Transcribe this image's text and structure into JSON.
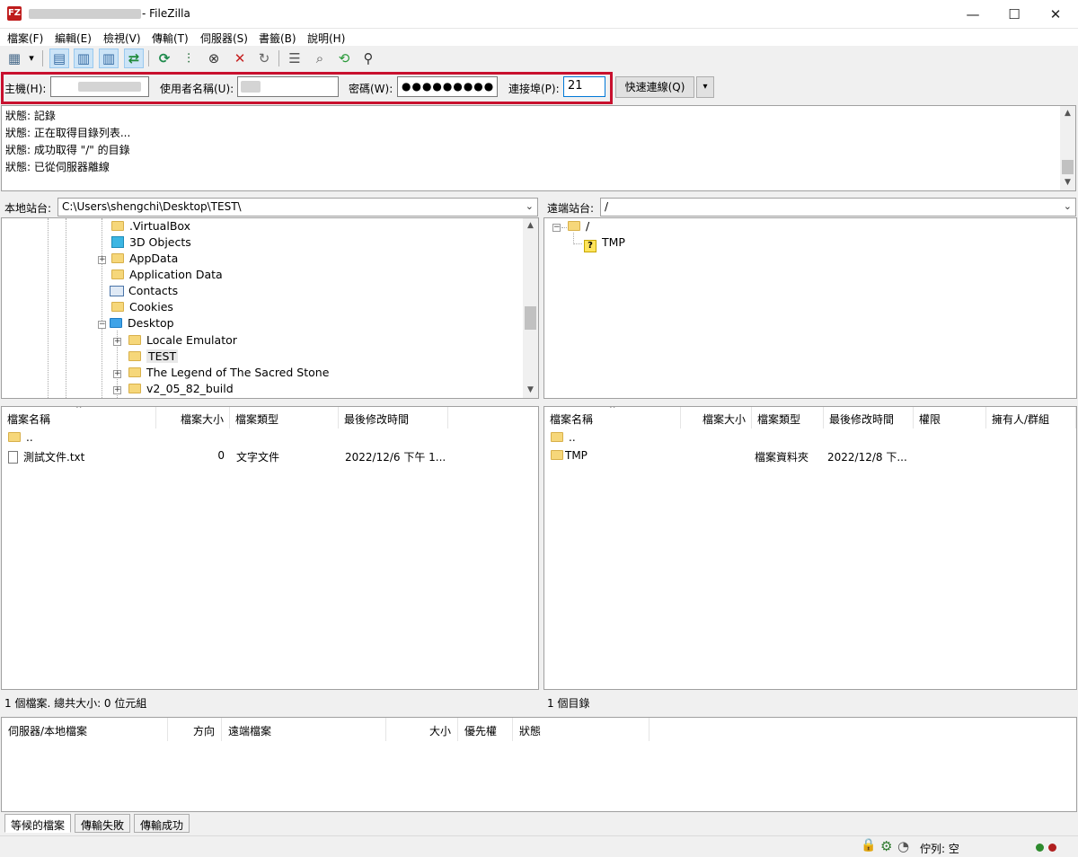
{
  "window": {
    "title_suffix": "- FileZilla",
    "icon_label": "FZ",
    "minimize": "—",
    "maximize": "☐",
    "close": "✕"
  },
  "menu": {
    "items": [
      "檔案(F)",
      "編輯(E)",
      "檢視(V)",
      "傳輸(T)",
      "伺服器(S)",
      "書籤(B)",
      "說明(H)"
    ]
  },
  "toolbar": {
    "icons": [
      {
        "name": "site-manager-icon",
        "glyph": "▦"
      },
      {
        "name": "dropdown-arrow-icon",
        "glyph": "▾"
      },
      {
        "name": "toggle-log-icon",
        "glyph": "▤"
      },
      {
        "name": "toggle-local-tree-icon",
        "glyph": "▥"
      },
      {
        "name": "toggle-remote-tree-icon",
        "glyph": "▥"
      },
      {
        "name": "toggle-queue-icon",
        "glyph": "⇄"
      },
      {
        "name": "refresh-icon",
        "glyph": "⟳"
      },
      {
        "name": "process-queue-icon",
        "glyph": "⫶"
      },
      {
        "name": "cancel-icon",
        "glyph": "⊗"
      },
      {
        "name": "disconnect-icon",
        "glyph": "✕"
      },
      {
        "name": "reconnect-icon",
        "glyph": "↻"
      },
      {
        "name": "directory-filter-icon",
        "glyph": "☰"
      },
      {
        "name": "compare-directories-icon",
        "glyph": "⌕"
      },
      {
        "name": "sync-browsing-icon",
        "glyph": "⟲"
      },
      {
        "name": "search-files-icon",
        "glyph": "⚲"
      }
    ]
  },
  "quickconnect": {
    "host_label": "主機(H):",
    "host_value": "",
    "username_label": "使用者名稱(U):",
    "username_value": "",
    "password_label": "密碼(W):",
    "password_value": "●●●●●●●●●",
    "port_label": "連接埠(P):",
    "port_value": "21",
    "connect_label": "快速連線(Q)",
    "dropdown_glyph": "▾"
  },
  "log": {
    "lines": [
      "狀態:  記錄",
      "狀態:  正在取得目錄列表...",
      "狀態:  成功取得 \"/\" 的目錄",
      "狀態:  已從伺服器離線"
    ]
  },
  "local_site": {
    "label": "本地站台:",
    "path": "C:\\Users\\shengchi\\Desktop\\TEST\\"
  },
  "remote_site": {
    "label": "遠端站台:",
    "path": "/"
  },
  "local_tree": {
    "items": [
      ".VirtualBox",
      "3D Objects",
      "AppData",
      "Application Data",
      "Contacts",
      "Cookies",
      "Desktop",
      "Locale Emulator",
      "TEST",
      "The Legend of The Sacred Stone",
      "v2_05_82_build"
    ]
  },
  "remote_tree": {
    "items": [
      "/",
      "TMP"
    ]
  },
  "local_list": {
    "columns": [
      "檔案名稱",
      "檔案大小",
      "檔案類型",
      "最後修改時間"
    ],
    "rows": [
      {
        "name": "..",
        "size": "",
        "type": "",
        "modified": ""
      },
      {
        "name": "測試文件.txt",
        "size": "0",
        "type": "文字文件",
        "modified": "2022/12/6 下午 1..."
      }
    ],
    "status": "1 個檔案. 總共大小: 0 位元組"
  },
  "remote_list": {
    "columns": [
      "檔案名稱",
      "檔案大小",
      "檔案類型",
      "最後修改時間",
      "權限",
      "擁有人/群組"
    ],
    "rows": [
      {
        "name": "..",
        "size": "",
        "type": "",
        "modified": ""
      },
      {
        "name": "TMP",
        "size": "",
        "type": "檔案資料夾",
        "modified": "2022/12/8 下..."
      }
    ],
    "status": "1 個目錄"
  },
  "queue": {
    "columns": [
      "伺服器/本地檔案",
      "方向",
      "遠端檔案",
      "大小",
      "優先權",
      "狀態"
    ],
    "tabs": [
      "等候的檔案",
      "傳輸失敗",
      "傳輸成功"
    ]
  },
  "statusbar": {
    "queue_text": "佇列: 空",
    "lock_icon": "🔒",
    "gear_icon": "⚙",
    "speed_icon": "◔"
  },
  "colors": {
    "highlight": "#c8102e",
    "selection": "#cce4f7"
  }
}
